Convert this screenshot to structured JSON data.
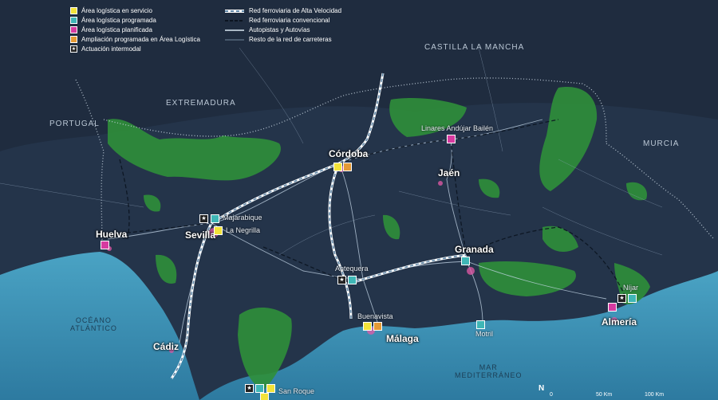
{
  "legend": {
    "areas": [
      {
        "label": "Área logística en servicio",
        "color": "#f2e23a",
        "icon": "square"
      },
      {
        "label": "Área logística programada",
        "color": "#3fb6b6",
        "icon": "square"
      },
      {
        "label": "Área logística planificada",
        "color": "#d63aa0",
        "icon": "square"
      },
      {
        "label": "Ampliación programada en Área Logística",
        "color": "#e59a35",
        "icon": "square"
      },
      {
        "label": "Actuación intermodal",
        "color": "#222222",
        "icon": "star"
      }
    ],
    "lines": [
      {
        "label": "Red ferroviaria de Alta Velocidad"
      },
      {
        "label": "Red ferroviaria convencional"
      },
      {
        "label": "Autopistas y Autovías"
      },
      {
        "label": "Resto de la red de carreteras"
      }
    ]
  },
  "regions": {
    "castilla": "CASTILLA LA MANCHA",
    "extremadura": "EXTREMADURA",
    "portugal": "PORTUGAL",
    "murcia": "MURCIA",
    "oceano": "OCÉANO\nATLÁNTICO",
    "mar": "MAR\nMEDITERRÁNEO"
  },
  "cities": {
    "cordoba": "Córdoba",
    "jaen": "Jaén",
    "granada": "Granada",
    "almeria": "Almería",
    "malaga": "Málaga",
    "cadiz": "Cádiz",
    "huelva": "Huelva",
    "sevilla": "Sevilla"
  },
  "sites": {
    "linares": "Linares Andújar Bailén",
    "majarabique": "Majarabique",
    "negrilla": "La Negrilla",
    "antequera": "Antequera",
    "buenavista": "Buenavista",
    "motril": "Motril",
    "nijar": "Níjar",
    "sanroque": "San Roque"
  },
  "scale": {
    "north": "N",
    "zero": "0",
    "fifty": "50 Km",
    "hundred": "100 Km"
  },
  "colors": {
    "servicio": "#f2e23a",
    "programada": "#3fb6b6",
    "planificada": "#d63aa0",
    "ampliacion": "#e59a35",
    "intermodal": "#222222",
    "forest": "#2f8f3a",
    "sea": "#3a93b6"
  }
}
